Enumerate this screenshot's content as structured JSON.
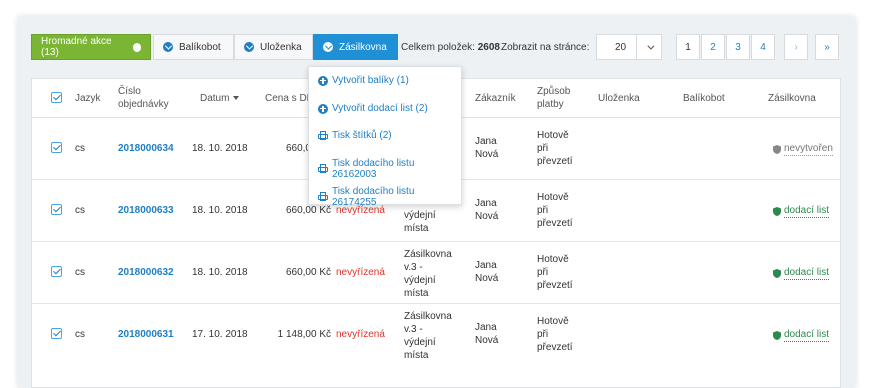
{
  "toolbar": {
    "bulk_label": "Hromadné akce (13)",
    "balikobot_label": "Balíkobot",
    "ulozenka_label": "Uloženka",
    "zasilkovna_label": "Zásilkovna",
    "total_label": "Celkem položek:",
    "total_value": "2608",
    "per_page_label": "Zobrazit na stránce:",
    "per_page_value": "20",
    "pages": [
      "1",
      "2",
      "3",
      "4"
    ],
    "next": "›",
    "last": "»"
  },
  "menu": {
    "items": [
      {
        "label": "Vytvořit balíky (1)",
        "icon": "plus-circle-icon"
      },
      {
        "label": "Vytvořit dodací list (2)",
        "icon": "plus-circle-icon"
      },
      {
        "label": "Tisk štítků (2)",
        "icon": "printer-icon"
      },
      {
        "label": "Tisk dodacího listu 26162003",
        "icon": "printer-icon"
      },
      {
        "label": "Tisk dodacího listu 26174255",
        "icon": "printer-icon"
      }
    ]
  },
  "table": {
    "headers": {
      "lang": "Jazyk",
      "order": "Číslo objednávky",
      "date": "Datum",
      "price": "Cena s DPH",
      "customer": "Zákazník",
      "payment": "Způsob platby",
      "ulozenka": "Uloženka",
      "balikobot": "Balíkobot",
      "zasilkovna": "Zásilkovna"
    },
    "rows": [
      {
        "lang": "cs",
        "order": "2018000634",
        "date": "18. 10. 2018",
        "price": "660,00 Kč",
        "status": "",
        "delivery": "",
        "customer": "Jana Nová",
        "payment": "Hotově při převzetí",
        "zasilkovna": "nevytvořen"
      },
      {
        "lang": "cs",
        "order": "2018000633",
        "date": "18. 10. 2018",
        "price": "660,00 Kč",
        "status": "nevyřízená",
        "delivery": "výdejní místa",
        "customer": "Jana Nová",
        "payment": "Hotově při převzetí",
        "zasilkovna": "dodací list"
      },
      {
        "lang": "cs",
        "order": "2018000632",
        "date": "18. 10. 2018",
        "price": "660,00 Kč",
        "status": "nevyřízená",
        "delivery": "Zásilkovna v.3 - výdejní místa",
        "customer": "Jana Nová",
        "payment": "Hotově při převzetí",
        "zasilkovna": "dodací list"
      },
      {
        "lang": "cs",
        "order": "2018000631",
        "date": "17. 10. 2018",
        "price": "1 148,00 Kč",
        "status": "nevyřízená",
        "delivery": "Zásilkovna v.3 - výdejní místa",
        "customer": "Jana Nová",
        "payment": "Hotově při převzetí",
        "zasilkovna": "dodací list"
      }
    ]
  },
  "colors": {
    "green": "#7ab534",
    "blue": "#1f8fd6",
    "link": "#1f7fc4",
    "red": "#e0342b",
    "status_green": "#2d8a4e"
  }
}
